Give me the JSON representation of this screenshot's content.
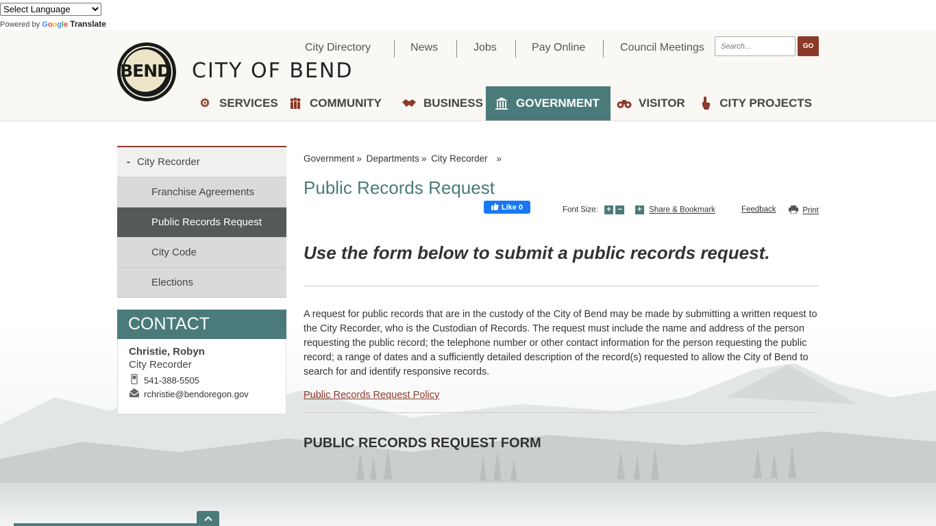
{
  "translate": {
    "select_label": "Select Language",
    "powered_by": "Powered by",
    "google": "Google",
    "translate_word": "Translate"
  },
  "brand": {
    "logo_text": "BEND",
    "city_name": "CITY OF BEND"
  },
  "top_links": [
    "City Directory",
    "News",
    "Jobs",
    "Pay Online",
    "Council Meetings"
  ],
  "search": {
    "placeholder": "Search...",
    "go_label": "GO"
  },
  "nav": {
    "items": [
      {
        "label": "SERVICES",
        "icon": "gears-icon"
      },
      {
        "label": "COMMUNITY",
        "icon": "people-icon"
      },
      {
        "label": "BUSINESS",
        "icon": "handshake-icon"
      },
      {
        "label": "GOVERNMENT",
        "icon": "capitol-building-icon",
        "active": true
      },
      {
        "label": "VISITOR",
        "icon": "binoculars-icon"
      },
      {
        "label": "CITY PROJECTS",
        "icon": "pointer-hand-icon"
      }
    ]
  },
  "sidebar": {
    "parent": "City Recorder",
    "parent_prefix": "-",
    "items": [
      "Franchise Agreements",
      "Public Records Request",
      "City Code",
      "Elections"
    ],
    "active_index": 1
  },
  "contact": {
    "heading": "CONTACT",
    "name": "Christie, Robyn",
    "title": "City Recorder",
    "phone": "541-388-5505",
    "email": "rchristie@bendoregon.gov"
  },
  "breadcrumb": {
    "items": [
      "Government",
      "Departments",
      "City Recorder"
    ],
    "separator": "»"
  },
  "page": {
    "title": "Public Records Request",
    "subheading": "Use the form below to submit a public records request.",
    "paragraph": "A request for public records that are in the custody of the City of Bend may be made by submitting a written request to the City Recorder, who is the Custodian of Records. The request must include the name and address of the person requesting the public record; the telephone number or other contact information for the person requesting the public record; a range of dates and a sufficiently detailed description of the record(s) requested to allow the City of Bend to search for and identify responsive records.",
    "policy_link": "Public Records Request Policy",
    "form_heading": "PUBLIC RECORDS REQUEST FORM"
  },
  "tools": {
    "fb_like": "Like 0",
    "font_size_label": "Font Size:",
    "share": "Share & Bookmark",
    "feedback": "Feedback",
    "print": "Print"
  },
  "colors": {
    "teal": "#4a7b7a",
    "rust": "#8b3a2a"
  }
}
